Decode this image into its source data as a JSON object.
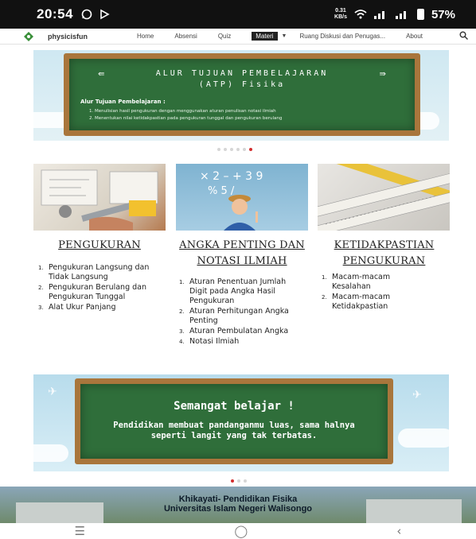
{
  "status_bar": {
    "time": "20:54",
    "speed_value": "0.31",
    "speed_unit": "KB/s",
    "battery": "57%"
  },
  "nav": {
    "brand": "physicisfun",
    "items": [
      "Home",
      "Absensi",
      "Quiz",
      "Materi",
      "Ruang Diskusi dan Penugas...",
      "About"
    ],
    "active": "Materi"
  },
  "banner1": {
    "title_line1": "ALUR TUJUAN PEMBELAJARAN",
    "title_line2": "(ATP) Fisika",
    "subtitle": "Alur Tujuan Pembelajaran      :",
    "items": [
      "Menulisian hasil pengukuran dengan menggunakan aturan penulisan notasi ilmiah",
      "Menentukan nilai ketidakpastian pada pengukuran tunggal dan pengukuran berulang"
    ]
  },
  "cards": [
    {
      "title": "PENGUKURAN",
      "items": [
        "Pengukuran Langsung dan Tidak Langsung",
        "Pengukuran Berulang dan Pengukuran Tunggal",
        "Alat Ukur Panjang"
      ]
    },
    {
      "title": "ANGKA PENTING DAN NOTASI ILMIAH",
      "items": [
        "Aturan Penentuan Jumlah Digit pada Angka Hasil Pengukuran",
        "Aturan Perhitungan Angka Penting",
        "Aturan Pembulatan Angka",
        "Notasi Ilmiah"
      ]
    },
    {
      "title": "KETIDAKPASTIAN PENGUKURAN",
      "items": [
        "Macam-macam Kesalahan",
        "Macam-macam Ketidakpastian"
      ]
    }
  ],
  "banner2": {
    "heading": "Semangat belajar !",
    "text": "Pendidikan membuat pandanganmu luas, sama halnya seperti langit yang tak terbatas."
  },
  "footer": {
    "line1": "Khikayati- Pendidikan Fisika",
    "line2": "Universitas Islam Negeri Walisongo"
  },
  "colors": {
    "chalkboard": "#2f6e3a",
    "frame": "#a9763c",
    "active_dot": "#d32f2f"
  }
}
